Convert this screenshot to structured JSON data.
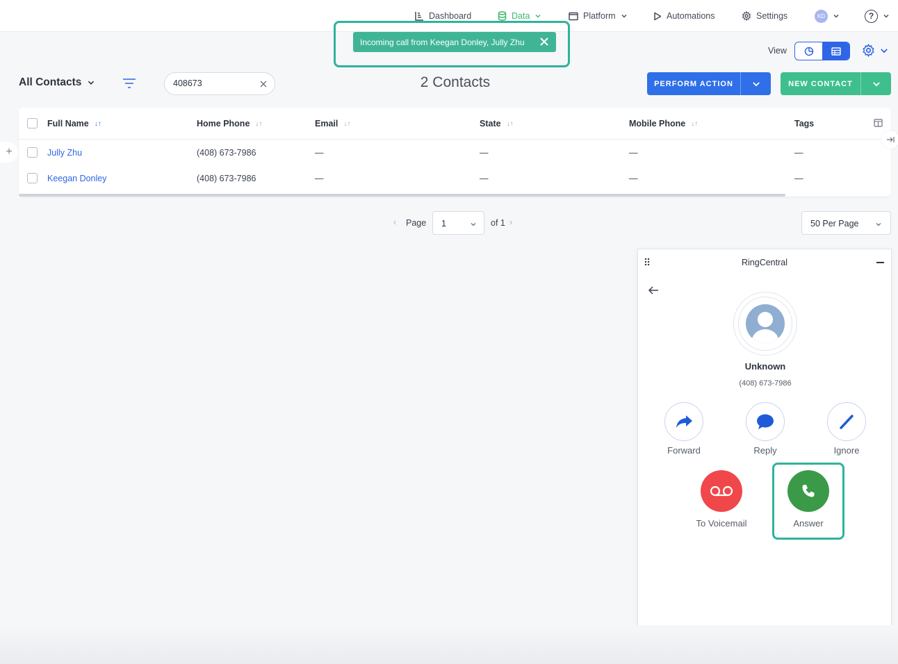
{
  "nav": {
    "items": [
      {
        "label": "Dashboard",
        "icon": "chart-icon"
      },
      {
        "label": "Data",
        "icon": "database-icon",
        "active": true
      },
      {
        "label": "Platform",
        "icon": "window-icon"
      },
      {
        "label": "Automations",
        "icon": "play-icon"
      },
      {
        "label": "Settings",
        "icon": "gear-icon"
      }
    ],
    "avatar_initials": "KD",
    "help_label": "?"
  },
  "toast": {
    "message": "Incoming call from Keegan Donley, Jully Zhu"
  },
  "view": {
    "label": "View",
    "selected": "table"
  },
  "toolbar": {
    "list_name": "All Contacts",
    "search_value": "408673",
    "count_label": "2 Contacts",
    "perform_action_label": "PERFORM ACTION",
    "new_contact_label": "NEW CONTACT"
  },
  "table": {
    "columns": [
      "Full Name",
      "Home Phone",
      "Email",
      "State",
      "Mobile Phone",
      "Tags"
    ],
    "rows": [
      {
        "full_name": "Jully Zhu",
        "home_phone": "(408) 673-7986",
        "email": "—",
        "state": "—",
        "mobile_phone": "—",
        "tags": "—"
      },
      {
        "full_name": "Keegan Donley",
        "home_phone": "(408) 673-7986",
        "email": "—",
        "state": "—",
        "mobile_phone": "—",
        "tags": "—"
      }
    ]
  },
  "pagination": {
    "page_label": "Page",
    "current_page": "1",
    "of_label": "of 1",
    "per_page": "50 Per Page"
  },
  "ringcentral": {
    "title": "RingCentral",
    "caller_name": "Unknown",
    "caller_number": "(408) 673-7986",
    "actions": {
      "forward": "Forward",
      "reply": "Reply",
      "ignore": "Ignore",
      "voicemail": "To Voicemail",
      "answer": "Answer"
    },
    "colors": {
      "voicemail": "#f0474a",
      "answer": "#3a9a48",
      "action_icon": "#1f5bd9"
    }
  },
  "colors": {
    "primary": "#2f6fe8",
    "success": "#3ebf8d",
    "toast": "#3fb596",
    "highlight": "#2fb39a"
  }
}
